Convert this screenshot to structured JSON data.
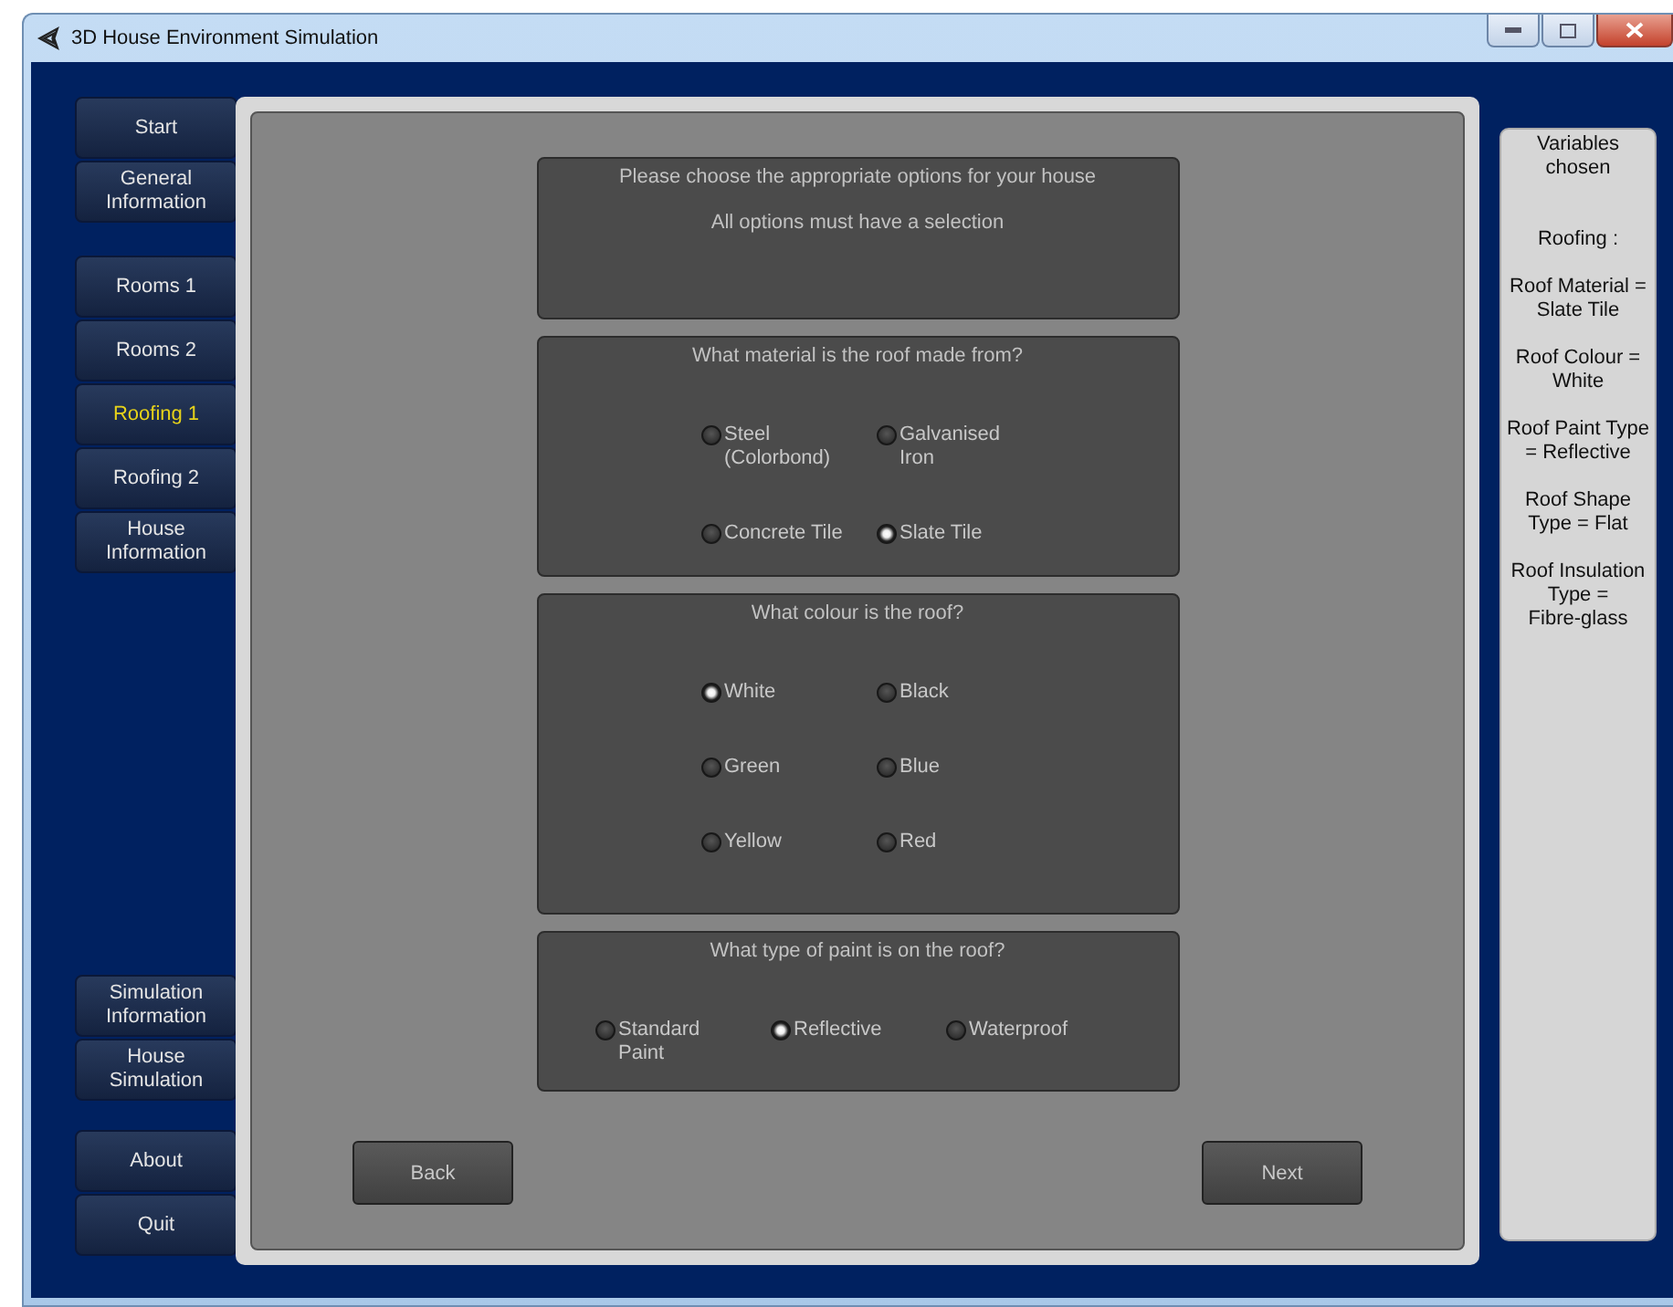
{
  "window": {
    "title": "3D House Environment Simulation"
  },
  "sidebar": {
    "groups": [
      {
        "items": [
          {
            "label": "Start",
            "selected": false
          },
          {
            "label": "General\nInformation",
            "selected": false
          }
        ]
      },
      {
        "items": [
          {
            "label": "Rooms 1",
            "selected": false
          },
          {
            "label": "Rooms 2",
            "selected": false
          },
          {
            "label": "Roofing 1",
            "selected": true
          },
          {
            "label": "Roofing 2",
            "selected": false
          },
          {
            "label": "House\nInformation",
            "selected": false
          }
        ]
      },
      {
        "items": [
          {
            "label": "Simulation\nInformation",
            "selected": false
          },
          {
            "label": "House\nSimulation",
            "selected": false
          }
        ]
      },
      {
        "items": [
          {
            "label": "About",
            "selected": false
          },
          {
            "label": "Quit",
            "selected": false
          }
        ]
      }
    ]
  },
  "intro": {
    "title": "Please choose the appropriate options for your house",
    "note": "All options must have a selection"
  },
  "questions": [
    {
      "title": "What material is the roof made from?",
      "options": [
        {
          "label": "Steel\n(Colorbond)",
          "selected": false
        },
        {
          "label": "Galvanised\nIron",
          "selected": false
        },
        {
          "label": "Concrete Tile",
          "selected": false
        },
        {
          "label": "Slate Tile",
          "selected": true
        }
      ]
    },
    {
      "title": "What colour is the roof?",
      "options": [
        {
          "label": "White",
          "selected": true
        },
        {
          "label": "Black",
          "selected": false
        },
        {
          "label": "Green",
          "selected": false
        },
        {
          "label": "Blue",
          "selected": false
        },
        {
          "label": "Yellow",
          "selected": false
        },
        {
          "label": "Red",
          "selected": false
        }
      ]
    },
    {
      "title": "What type of paint is on the roof?",
      "options": [
        {
          "label": "Standard\nPaint",
          "selected": false
        },
        {
          "label": "Reflective",
          "selected": true
        },
        {
          "label": "Waterproof",
          "selected": false
        }
      ]
    }
  ],
  "buttons": [
    "Back",
    "Next"
  ],
  "variables_panel": {
    "title": "Variables\nchosen",
    "lines": [
      "Roofing :",
      "Roof Material =\nSlate Tile",
      "Roof Colour =\nWhite",
      "Roof Paint Type\n= Reflective",
      "Roof Shape\nType = Flat",
      "Roof Insulation\nType =\nFibre-glass"
    ]
  }
}
